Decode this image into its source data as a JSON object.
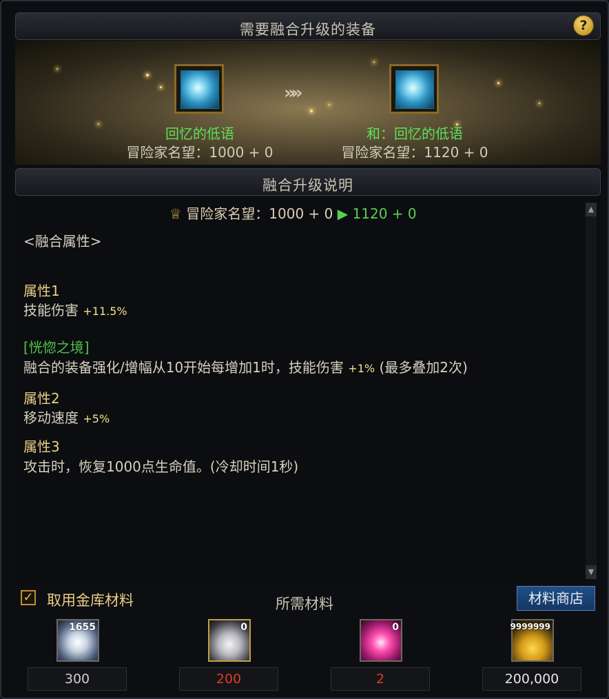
{
  "header": {
    "title": "需要融合升级的装备",
    "help_label": "?"
  },
  "fusion": {
    "source": {
      "name": "回忆的低语",
      "stat": "冒险家名望：1000 + 0",
      "icon": "item-orb-icon"
    },
    "arrow": "»»",
    "result": {
      "name": "和：回忆的低语",
      "stat": "冒险家名望：1120 + 0",
      "icon": "item-orb-icon"
    }
  },
  "description": {
    "title": "融合升级说明",
    "reputation": {
      "label": "冒险家名望",
      "before": "：1000 + 0",
      "after": "1120 + 0"
    },
    "section_header": "<融合属性>",
    "attr1": {
      "title": "属性1",
      "text": "技能伤害",
      "value": "+11.5%"
    },
    "set": {
      "title": "[恍惚之境]",
      "text": "融合的装备强化/增幅从10开始每增加1时，技能伤害",
      "value": "+1%",
      "suffix": "(最多叠加2次)"
    },
    "attr2": {
      "title": "属性2",
      "text": "移动速度",
      "value": "+5%"
    },
    "attr3": {
      "title": "属性3",
      "text": "攻击时，恢复1000点生命值。(冷却时间1秒)"
    }
  },
  "materials": {
    "checkbox_label": "取用金库材料",
    "checkbox_checked": true,
    "title": "所需材料",
    "shop_button": "材料商店",
    "items": [
      {
        "icon": "white-orb-icon",
        "owned": "1655",
        "required": "300",
        "color": "#cfcfcf"
      },
      {
        "icon": "crystal-icon",
        "owned": "0",
        "required": "200",
        "color": "#e03a2a"
      },
      {
        "icon": "pink-gear-icon",
        "owned": "0",
        "required": "2",
        "color": "#e03a2a"
      },
      {
        "icon": "gold-coins-icon",
        "owned": "9999999",
        "required": "200,000",
        "color": "#e6e6e6"
      }
    ]
  }
}
